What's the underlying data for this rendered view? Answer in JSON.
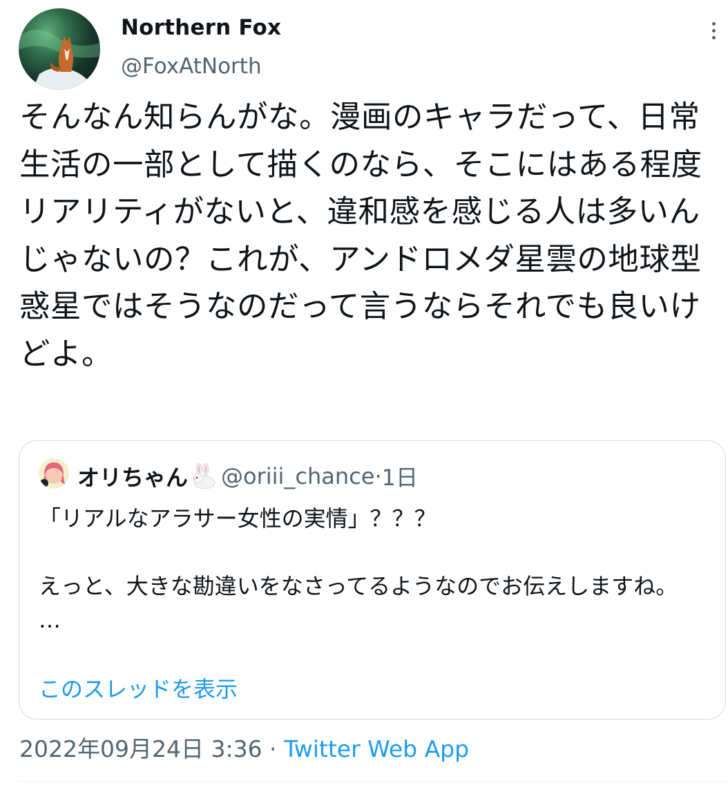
{
  "author": {
    "display_name": "Northern Fox",
    "handle": "@FoxAtNorth",
    "avatar_icon": "fox-avatar"
  },
  "more_icon": "more-options-icon",
  "tweet": {
    "text": "そんなん知らんがな。漫画のキャラだって、日常生活の一部として描くのなら、そこにはある程度リアリティがないと、違和感を感じる人は多いんじゃないの？これが、アンドロメダ星雲の地球型惑星ではそうなのだって言うならそれでも良いけどよ。"
  },
  "quote": {
    "display_name": "オリちゃん",
    "emoji_icon": "rabbit-emoji-icon",
    "handle": "@oriii_chance",
    "separator": " · ",
    "time_ago": "1日",
    "body": "「リアルなアラサー女性の実情」？？？\n\nえっと、大きな勘違いをなさってるようなのでお伝えしますね。\n…",
    "show_thread": "このスレッドを表示"
  },
  "meta": {
    "datetime": "2022年09月24日 3:36",
    "separator": " · ",
    "app": "Twitter Web App"
  },
  "colors": {
    "text": "#0f1419",
    "secondary": "#536471",
    "link": "#1d9bf0",
    "border": "#cfd9de"
  }
}
